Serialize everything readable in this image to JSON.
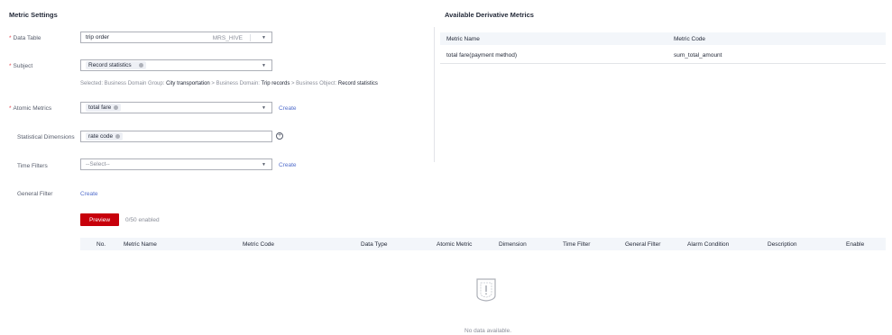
{
  "settings": {
    "title": "Metric Settings",
    "data_table": {
      "label": "Data Table",
      "value": "trip order",
      "tag": "MRS_HIVE"
    },
    "subject": {
      "label": "Subject",
      "value": "Record statistics"
    },
    "selected_hint": {
      "prefix": "Selected: Business Domain Group: ",
      "group": "City transportation",
      "sep1": " > Business Domain: ",
      "domain": "Trip records",
      "sep2": " > Business Object: ",
      "object": "Record statistics"
    },
    "atomic_metrics": {
      "label": "Atomic Metrics",
      "value": "total fare",
      "create": "Create"
    },
    "statistical_dimensions": {
      "label": "Statistical Dimensions",
      "value": "rate code"
    },
    "time_filters": {
      "label": "Time Filters",
      "placeholder": "--Select--",
      "create": "Create"
    },
    "general_filter": {
      "label": "General Filter",
      "create": "Create"
    }
  },
  "preview": {
    "button": "Preview",
    "count": "0/50 enabled"
  },
  "table": {
    "columns": [
      "No.",
      "Metric Name",
      "Metric Code",
      "Data Type",
      "Atomic Metric",
      "Dimension",
      "Time Filter",
      "General Filter",
      "Alarm Condition",
      "Description",
      "Enable"
    ],
    "empty_text": "No data available."
  },
  "derivative": {
    "title": "Available Derivative Metrics",
    "columns": [
      "Metric Name",
      "Metric Code"
    ],
    "rows": [
      {
        "name": "total fare(payment method)",
        "code": "sum_total_amount"
      }
    ]
  },
  "colors": {
    "accent": "#c7000b",
    "link": "#526ecc",
    "required": "#e6454d"
  }
}
